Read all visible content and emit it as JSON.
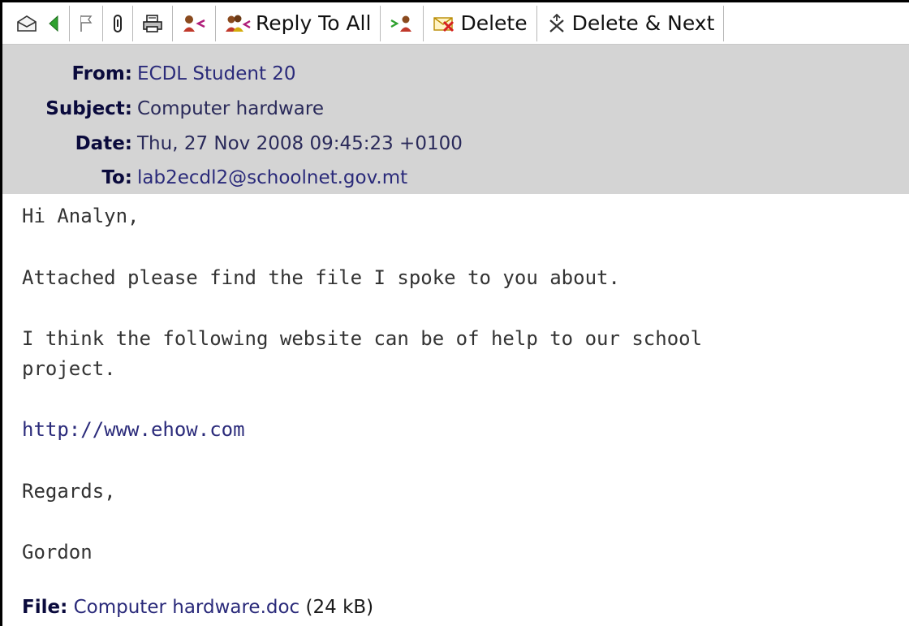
{
  "toolbar": {
    "buttons": [
      {
        "icon": "envelope-icon"
      },
      {
        "icon": "back-arrow-icon"
      },
      {
        "icon": "flag-icon"
      },
      {
        "icon": "paperclip-icon"
      },
      {
        "icon": "printer-icon"
      },
      {
        "icon": "reply-icon"
      },
      {
        "icon": "reply-all-icon",
        "label": "Reply To All"
      },
      {
        "icon": "forward-icon"
      },
      {
        "icon": "delete-icon",
        "label": "Delete"
      },
      {
        "icon": "delete-next-icon",
        "label": "Delete & Next"
      }
    ]
  },
  "header": {
    "from_label": "From:",
    "from_value": "ECDL Student 20",
    "subject_label": "Subject:",
    "subject_value": "Computer hardware",
    "date_label": "Date:",
    "date_value": "Thu, 27 Nov 2008 09:45:23 +0100",
    "to_label": "To:",
    "to_value": "lab2ecdl2@schoolnet.gov.mt"
  },
  "message": {
    "greeting": "Hi Analyn,",
    "line1": "Attached please find the file I spoke to you about.",
    "line2a": "I think the following website can be of help to our school",
    "line2b": "project.",
    "link": "http://www.ehow.com",
    "closing": "Regards,",
    "signature": "Gordon"
  },
  "attachment": {
    "label": "File:",
    "name": "Computer hardware.doc",
    "size": "(24 kB)"
  },
  "colors": {
    "header_bg": "#d4d4d4",
    "link": "#2a2a7a",
    "label": "#0a0a3c"
  }
}
